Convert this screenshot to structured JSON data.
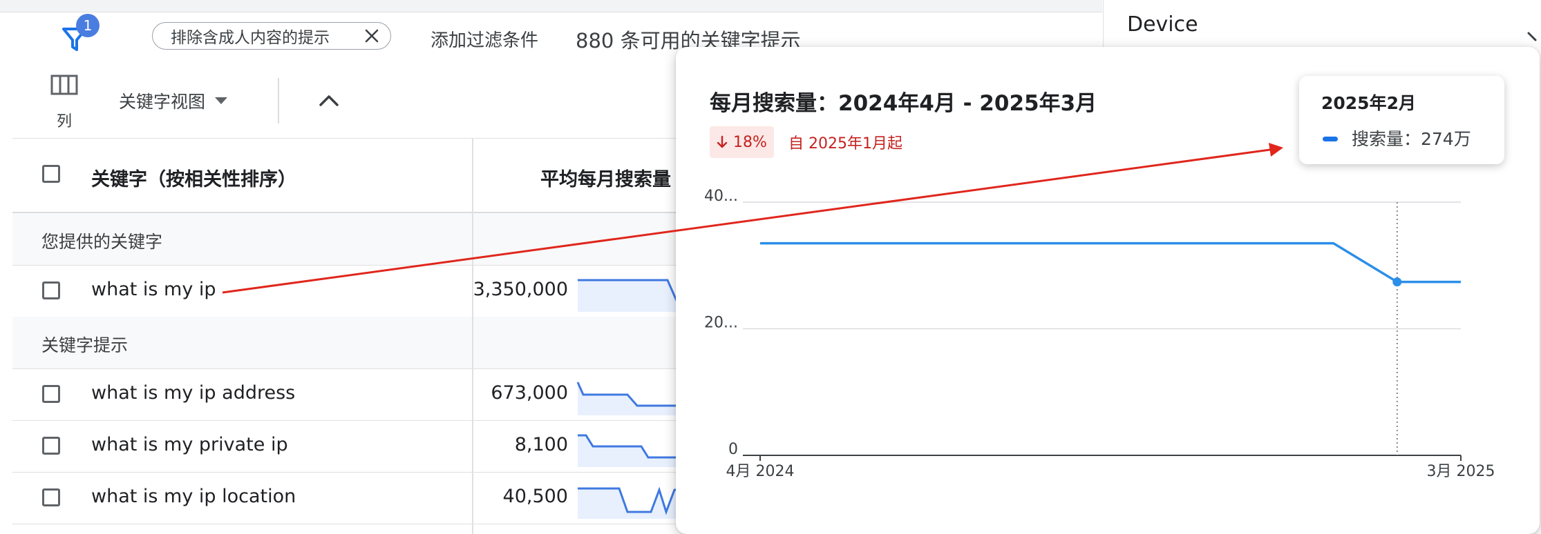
{
  "toolbar": {
    "filter_badge": "1",
    "chip_label": "排除含成人内容的提示",
    "add_filter": "添加过滤条件",
    "keyword_count": "880 条可用的关键字提示",
    "columns_label": "列",
    "keyword_view": "关键字视图"
  },
  "table": {
    "header_keyword": "关键字（按相关性排序）",
    "header_avg": "平均每月搜索量",
    "section_provided": "您提供的关键字",
    "section_suggestions": "关键字提示",
    "provided": [
      {
        "keyword": "what is my ip",
        "volume": "3,350,000"
      }
    ],
    "suggestions": [
      {
        "keyword": "what is my ip address",
        "volume": "673,000"
      },
      {
        "keyword": "what is my private ip",
        "volume": "8,100"
      },
      {
        "keyword": "what is my ip location",
        "volume": "40,500"
      }
    ]
  },
  "right_panel": {
    "device_label": "Device"
  },
  "popup": {
    "title": "每月搜索量：2024年4月 - 2025年3月",
    "trend_pct": "18%",
    "trend_text": "自 2025年1月起",
    "tooltip_month": "2025年2月",
    "tooltip_value": "搜索量：274万"
  },
  "colors": {
    "line": "#2b8fe8",
    "sparkline": "#3f79e0",
    "sparkfill": "#e8f0fe",
    "trend_down": "#c5221f",
    "annotation": "#e0261c"
  },
  "chart_data": {
    "type": "line",
    "title": "每月搜索量：2024年4月 - 2025年3月",
    "x": [
      "2024-04",
      "2024-05",
      "2024-06",
      "2024-07",
      "2024-08",
      "2024-09",
      "2024-10",
      "2024-11",
      "2024-12",
      "2025-01",
      "2025-02",
      "2025-03"
    ],
    "x_tick_labels": [
      "4月 2024",
      "3月 2025"
    ],
    "series": [
      {
        "name": "搜索量",
        "values": [
          335,
          335,
          335,
          335,
          335,
          335,
          335,
          335,
          335,
          335,
          274,
          274
        ]
      }
    ],
    "y_tick_labels": [
      "0",
      "20...",
      "40..."
    ],
    "y_ticks": [
      0,
      200,
      400
    ],
    "ylim": [
      0,
      400
    ],
    "highlight_index": 10,
    "grid": true
  }
}
